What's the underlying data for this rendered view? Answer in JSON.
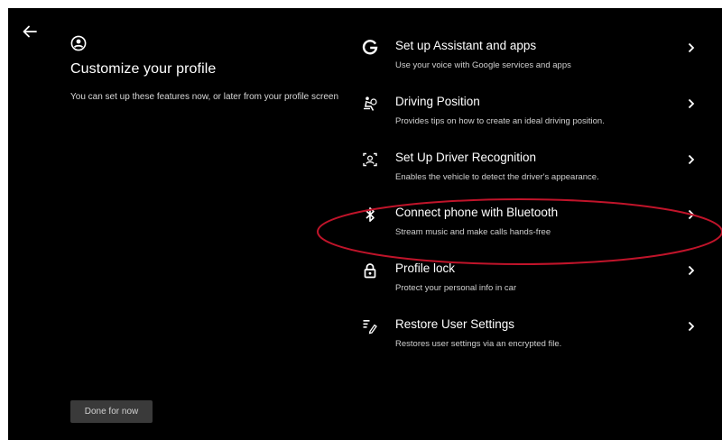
{
  "left_panel": {
    "title": "Customize your profile",
    "description": "You can set up these features now, or later from your profile screen",
    "done_label": "Done for now"
  },
  "settings": {
    "items": [
      {
        "title": "Set up Assistant and apps",
        "subtitle": "Use your voice with Google services and apps",
        "icon": "google-g-icon"
      },
      {
        "title": "Driving Position",
        "subtitle": "Provides tips on how to create an ideal driving position.",
        "icon": "driver-seat-icon"
      },
      {
        "title": "Set Up Driver Recognition",
        "subtitle": "Enables the vehicle to detect the driver's appearance.",
        "icon": "face-scan-icon"
      },
      {
        "title": "Connect phone with Bluetooth",
        "subtitle": "Stream music and make calls hands-free",
        "icon": "bluetooth-icon"
      },
      {
        "title": "Profile lock",
        "subtitle": "Protect your personal info in car",
        "icon": "lock-icon"
      },
      {
        "title": "Restore User Settings",
        "subtitle": "Restores user settings via an encrypted file.",
        "icon": "restore-settings-icon"
      }
    ]
  },
  "colors": {
    "background": "#000000",
    "text_primary": "#ffffff",
    "text_secondary": "#cfcfcf",
    "button_bg": "#3a3a3a",
    "highlight_annotation": "#c0142a"
  }
}
